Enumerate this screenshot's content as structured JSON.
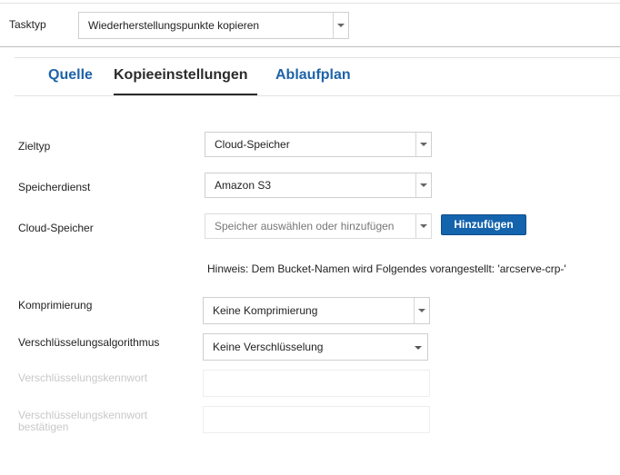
{
  "task": {
    "label": "Tasktyp",
    "value": "Wiederherstellungspunkte kopieren"
  },
  "tabs": [
    {
      "label": "Quelle"
    },
    {
      "label": "Kopieeinstellungen"
    },
    {
      "label": "Ablaufplan"
    }
  ],
  "form": {
    "zieltyp": {
      "label": "Zieltyp",
      "value": "Cloud-Speicher"
    },
    "speicherdienst": {
      "label": "Speicherdienst",
      "value": "Amazon S3"
    },
    "cloud_speicher": {
      "label": "Cloud-Speicher",
      "placeholder": "Speicher auswählen oder hinzufügen",
      "button": "Hinzufügen"
    },
    "hint": "Hinweis: Dem Bucket-Namen wird Folgendes vorangestellt: 'arcserve-crp-'",
    "komprimierung": {
      "label": "Komprimierung",
      "value": "Keine Komprimierung"
    },
    "verschluesselung": {
      "label": "Verschlüsselungsalgorithmus",
      "value": "Keine Verschlüsselung"
    },
    "kennwort": {
      "label": "Verschlüsselungskennwort"
    },
    "kennwort_bestaetigen": {
      "label_line1": "Verschlüsselungskennwort",
      "label_line2": "bestätigen"
    }
  },
  "colors": {
    "accent": "#1e63a8",
    "button": "#1463ad",
    "disabled_text": "#c8c8c8"
  }
}
